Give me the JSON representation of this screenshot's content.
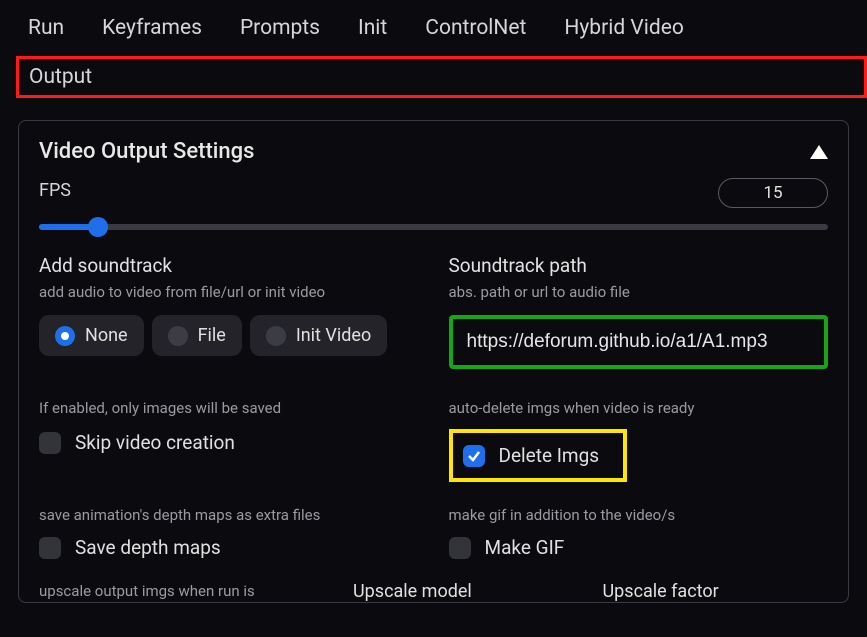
{
  "tabs": {
    "run": "Run",
    "keyframes": "Keyframes",
    "prompts": "Prompts",
    "init": "Init",
    "controlnet": "ControlNet",
    "hybrid": "Hybrid Video",
    "output": "Output"
  },
  "panel": {
    "title": "Video Output Settings",
    "fps_label": "FPS",
    "fps_value": "15"
  },
  "soundtrack": {
    "title": "Add soundtrack",
    "subtitle": "add audio to video from file/url or init video",
    "options": {
      "none": "None",
      "file": "File",
      "init": "Init Video"
    }
  },
  "soundtrack_path": {
    "title": "Soundtrack path",
    "subtitle": "abs. path or url to audio file",
    "value": "https://deforum.github.io/a1/A1.mp3"
  },
  "skip": {
    "note": "If enabled, only images will be saved",
    "label": "Skip video creation"
  },
  "delete": {
    "note": "auto-delete imgs when video is ready",
    "label": "Delete Imgs"
  },
  "depth": {
    "note": "save animation's depth maps as extra files",
    "label": "Save depth maps"
  },
  "gif": {
    "note": "make gif in addition to the video/s",
    "label": "Make GIF"
  },
  "upscale": {
    "note": "upscale output imgs when run is",
    "model_label": "Upscale model",
    "factor_label": "Upscale factor"
  }
}
